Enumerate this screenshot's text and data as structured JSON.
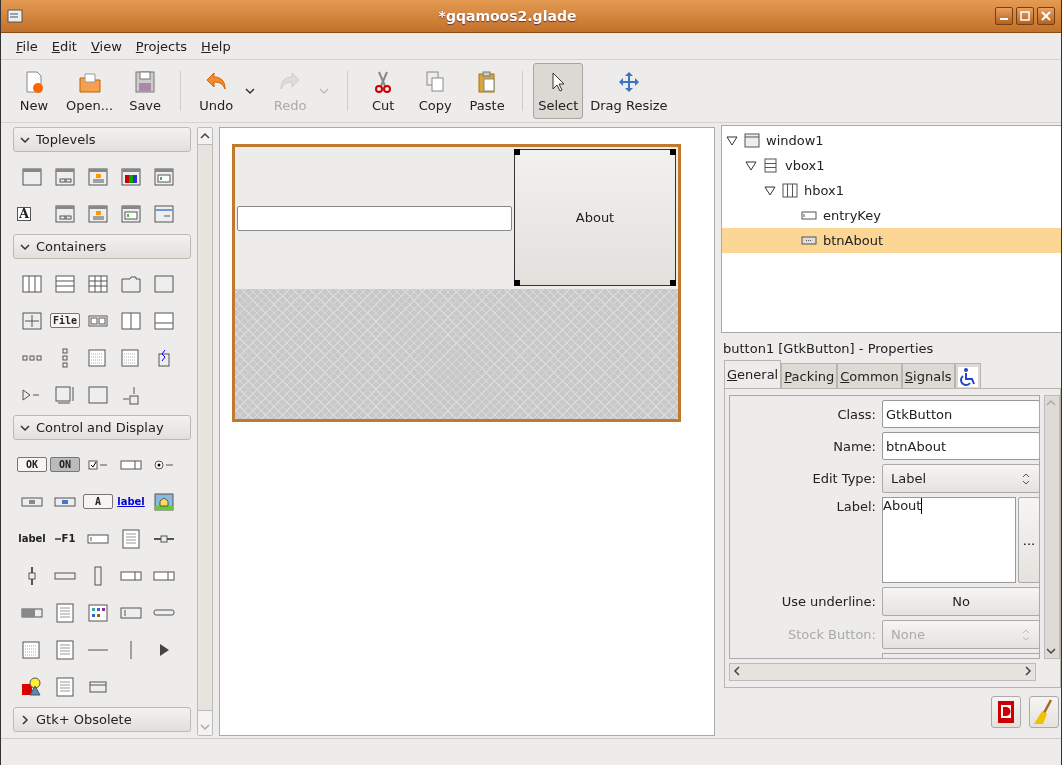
{
  "window": {
    "title": "*gqamoos2.glade"
  },
  "menu": [
    "File",
    "Edit",
    "View",
    "Projects",
    "Help"
  ],
  "toolbar": [
    {
      "kind": "new",
      "label": "New"
    },
    {
      "kind": "open",
      "label": "Open..."
    },
    {
      "kind": "save",
      "label": "Save"
    },
    {
      "kind": "separator"
    },
    {
      "kind": "undo",
      "label": "Undo",
      "disabled": false,
      "dropdown": true
    },
    {
      "kind": "redo",
      "label": "Redo",
      "disabled": true,
      "dropdown": true
    },
    {
      "kind": "separator"
    },
    {
      "kind": "cut",
      "label": "Cut"
    },
    {
      "kind": "copy",
      "label": "Copy"
    },
    {
      "kind": "paste",
      "label": "Paste"
    },
    {
      "kind": "separator"
    },
    {
      "kind": "select",
      "label": "Select",
      "selected": true
    },
    {
      "kind": "move",
      "label": "Drag Resize",
      "selected": false
    }
  ],
  "palette": [
    {
      "title": "Toplevels",
      "expanded": true,
      "items": [
        {
          "kind": "window"
        },
        {
          "kind": "dialog"
        },
        {
          "kind": "about"
        },
        {
          "kind": "color"
        },
        {
          "kind": "filedlg"
        },
        {
          "kind": "fontdlg",
          "text": "A"
        },
        {
          "kind": "input"
        },
        {
          "kind": "message"
        },
        {
          "kind": "recent"
        },
        {
          "kind": "assistant"
        }
      ]
    },
    {
      "title": "Containers",
      "expanded": true,
      "items": [
        {
          "kind": "hbox"
        },
        {
          "kind": "vbox"
        },
        {
          "kind": "table"
        },
        {
          "kind": "notebook"
        },
        {
          "kind": "frame"
        },
        {
          "kind": "fixed"
        },
        {
          "kind": "menubar",
          "text": "File"
        },
        {
          "kind": "toolbar"
        },
        {
          "kind": "hpaned"
        },
        {
          "kind": "vpaned"
        },
        {
          "kind": "hbuttonbox"
        },
        {
          "kind": "vbuttonbox"
        },
        {
          "kind": "layout"
        },
        {
          "kind": "grid"
        },
        {
          "kind": "alignment"
        },
        {
          "kind": "expander"
        },
        {
          "kind": "scrolled"
        },
        {
          "kind": "viewport"
        },
        {
          "kind": "eventbox"
        }
      ]
    },
    {
      "title": "Control and Display",
      "expanded": true,
      "items": [
        {
          "kind": "okbutton",
          "text": "OK"
        },
        {
          "kind": "togglebutton",
          "text": "ON"
        },
        {
          "kind": "check"
        },
        {
          "kind": "spin"
        },
        {
          "kind": "radio"
        },
        {
          "kind": "filebutton"
        },
        {
          "kind": "colorbutton"
        },
        {
          "kind": "fontbutton",
          "text": "A"
        },
        {
          "kind": "link",
          "text": "label"
        },
        {
          "kind": "image"
        },
        {
          "kind": "label",
          "text": "label"
        },
        {
          "kind": "accel",
          "text": "F1"
        },
        {
          "kind": "entry"
        },
        {
          "kind": "textview"
        },
        {
          "kind": "hscale"
        },
        {
          "kind": "vscale"
        },
        {
          "kind": "hscroll"
        },
        {
          "kind": "vscroll"
        },
        {
          "kind": "combo"
        },
        {
          "kind": "comboentry"
        },
        {
          "kind": "progress"
        },
        {
          "kind": "treeview"
        },
        {
          "kind": "iconview"
        },
        {
          "kind": "handlebox"
        },
        {
          "kind": "statusbar"
        },
        {
          "kind": "calendar"
        },
        {
          "kind": "menu"
        },
        {
          "kind": "hsep"
        },
        {
          "kind": "vsep"
        },
        {
          "kind": "arrow"
        },
        {
          "kind": "drawing"
        },
        {
          "kind": "list"
        },
        {
          "kind": "cellview"
        }
      ]
    },
    {
      "title": "Gtk+ Obsolete",
      "expanded": false
    }
  ],
  "design": {
    "button": {
      "label": "About",
      "selected": true
    }
  },
  "tree": [
    {
      "name": "window1",
      "kind": "window",
      "expanded": true,
      "selected": false,
      "children": [
        {
          "name": "vbox1",
          "kind": "vbox",
          "expanded": true,
          "selected": false,
          "children": [
            {
              "name": "hbox1",
              "kind": "hbox",
              "expanded": true,
              "selected": false,
              "children": [
                {
                  "name": "entryKey",
                  "kind": "entry",
                  "selected": false
                },
                {
                  "name": "btnAbout",
                  "kind": "button",
                  "selected": true
                }
              ]
            }
          ]
        }
      ]
    }
  ],
  "properties": {
    "title": "button1 [GtkButton] - Properties",
    "tabs": [
      {
        "label": "General",
        "kind": "text",
        "selected": true
      },
      {
        "label": "Packing",
        "kind": "text",
        "selected": false
      },
      {
        "label": "Common",
        "kind": "text",
        "selected": false
      },
      {
        "label": "Signals",
        "kind": "text",
        "selected": false
      },
      {
        "kind": "accessibility",
        "selected": false
      }
    ],
    "rows": [
      {
        "label": "Class:",
        "kind": "entry",
        "value": "GtkButton",
        "disabled": false
      },
      {
        "label": "Name:",
        "kind": "entry",
        "value": "btnAbout",
        "disabled": false
      },
      {
        "label": "Edit Type:",
        "kind": "combo",
        "value": "Label",
        "disabled": false
      },
      {
        "label": "Label:",
        "kind": "textarea",
        "value": "About",
        "button": "...",
        "disabled": false
      },
      {
        "label": "Use underline:",
        "kind": "toggle",
        "value": "No",
        "disabled": false
      },
      {
        "label": "Stock Button:",
        "kind": "combo",
        "value": "None",
        "disabled": true
      }
    ]
  }
}
